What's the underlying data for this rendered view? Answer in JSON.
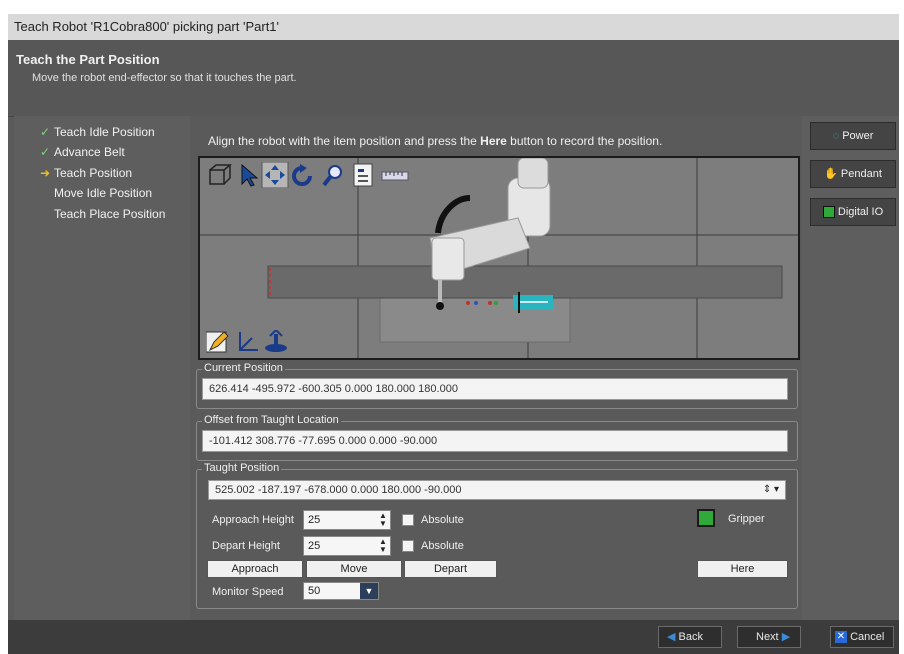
{
  "window": {
    "title": "Teach Robot 'R1Cobra800' picking part 'Part1'"
  },
  "header": {
    "title": "Teach the Part Position",
    "subtitle": "Move the robot end-effector so that it touches the part."
  },
  "steps": [
    {
      "label": "Teach Idle Position",
      "state": "done"
    },
    {
      "label": "Advance Belt",
      "state": "done"
    },
    {
      "label": "Teach Position",
      "state": "current"
    },
    {
      "label": "Move Idle Position",
      "state": "pending"
    },
    {
      "label": "Teach Place Position",
      "state": "pending"
    }
  ],
  "main": {
    "instruction_prefix": "Align the robot with the item position and press the ",
    "instruction_bold": "Here",
    "instruction_suffix": " button to record the position.",
    "viewport_toolbar_icons": [
      "view-cube-icon",
      "select-arrow-icon",
      "pan-icon",
      "rotate-icon",
      "zoom-icon",
      "properties-icon",
      "ruler-icon"
    ],
    "viewport_bottom_icons": [
      "edit-icon",
      "axes-icon",
      "joint-icon"
    ]
  },
  "current_position": {
    "label": "Current Position",
    "value": "626.414 -495.972 -600.305 0.000 180.000 180.000"
  },
  "offset": {
    "label": "Offset from Taught Location",
    "value": "-101.412 308.776 -77.695 0.000 0.000 -90.000"
  },
  "taught": {
    "label": "Taught Position",
    "value": "525.002 -187.197 -678.000 0.000 180.000 -90.000",
    "approach_label": "Approach Height",
    "approach_value": "25",
    "depart_label": "Depart Height",
    "depart_value": "25",
    "absolute_label": "Absolute",
    "absolute_checked": false,
    "gripper_label": "Gripper",
    "gripper_color": "#2faa3a",
    "buttons": {
      "approach": "Approach",
      "move": "Move",
      "depart": "Depart",
      "here": "Here"
    },
    "speed_label": "Monitor Speed",
    "speed_value": "50"
  },
  "right": {
    "power": "Power",
    "pendant": "Pendant",
    "digital_io": "Digital IO"
  },
  "footer": {
    "back": "Back",
    "next": "Next",
    "cancel": "Cancel"
  },
  "colors": {
    "done_check": "#7dd77d",
    "current_arrow": "#f0c020",
    "conveyor_part": "#2ab4c0"
  }
}
